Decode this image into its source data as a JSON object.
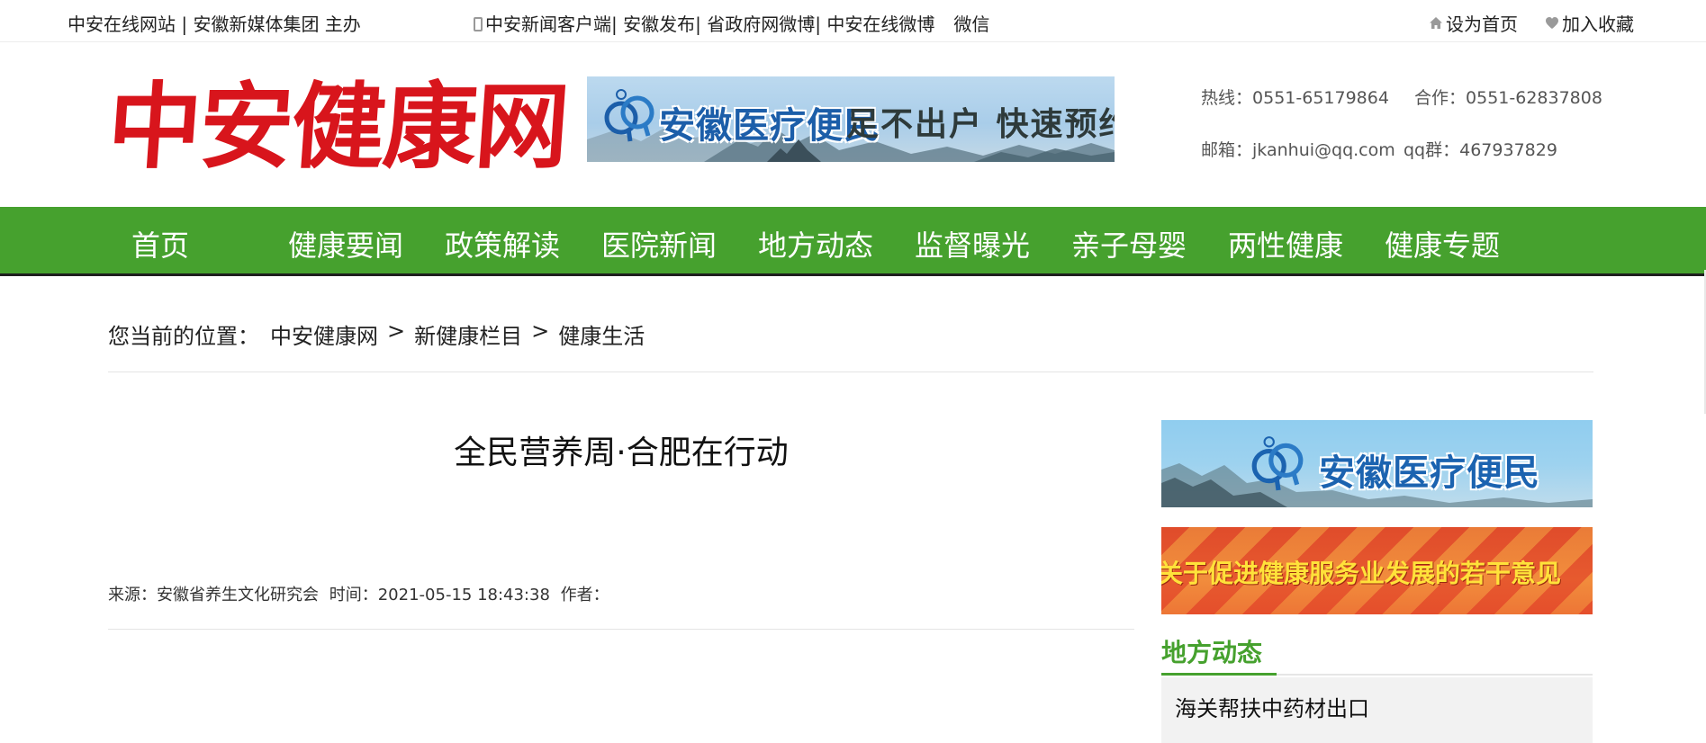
{
  "topbar": {
    "host": "中安在线网站 | 安徽新媒体集团 主办",
    "links": [
      {
        "label": "中安新闻客户端"
      },
      {
        "label": "| 安徽发布"
      },
      {
        "label": "| 省政府网微博"
      },
      {
        "label": "| 中安在线微博"
      }
    ],
    "wechat": "微信",
    "set_home": "设为首页",
    "add_favorite": "加入收藏"
  },
  "header": {
    "logo_text": "中安健康网",
    "banner": {
      "title": "安徽医疗便民",
      "slogan": "足不出户 快速预约",
      "logo_icon": "qq-app-logo-icon"
    },
    "contact": {
      "hotline_label": "热线：",
      "hotline": "0551-65179864",
      "coop_label": "合作：",
      "coop": "0551-62837808",
      "email_label": "邮箱：",
      "email": "jkanhui@qq.com",
      "qq_label": "qq群：",
      "qq": "467937829"
    }
  },
  "nav": {
    "items": [
      {
        "label": "首页"
      },
      {
        "label": "健康要闻"
      },
      {
        "label": "政策解读"
      },
      {
        "label": "医院新闻"
      },
      {
        "label": "地方动态"
      },
      {
        "label": "监督曝光"
      },
      {
        "label": "亲子母婴"
      },
      {
        "label": "两性健康"
      },
      {
        "label": "健康专题"
      }
    ],
    "color": "#46a12e"
  },
  "breadcrumb": {
    "prefix": "您当前的位置：",
    "items": [
      {
        "label": "中安健康网"
      },
      {
        "label": "新健康栏目"
      },
      {
        "label": "健康生活"
      }
    ],
    "separator": ">"
  },
  "article": {
    "title": "全民营养周·合肥在行动",
    "source_label": "来源：",
    "source": "安徽省养生文化研究会",
    "time_label": "时间：",
    "time": "2021-05-15 18:43:38",
    "author_label": "作者："
  },
  "sidebar": {
    "banner1_title": "安徽医疗便民",
    "banner2_title": "关于促进健康服务业发展的若干意见",
    "section_title": "地方动态",
    "list": [
      {
        "label": "海关帮扶中药材出口"
      }
    ]
  }
}
